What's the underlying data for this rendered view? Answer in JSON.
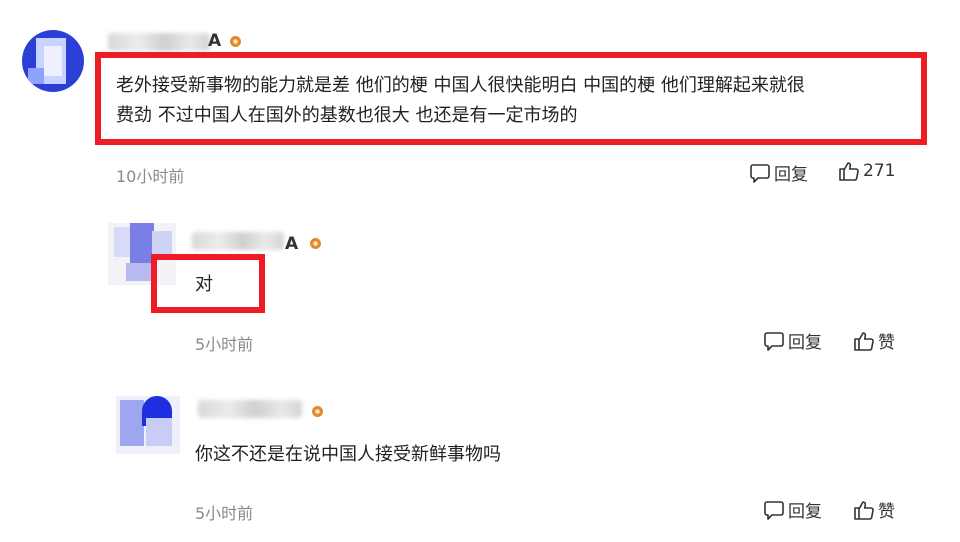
{
  "comments": [
    {
      "username_visible_tail": "A",
      "text": "老外接受新事物的能力就是差 他们的梗 中国人很快能明白 中国的梗 他们理解起来就很费劲 不过中国人在国外的基数也很大 也还是有一定市场的",
      "text_line1": "老外接受新事物的能力就是差 他们的梗 中国人很快能明白 中国的梗 他们理解起来就很",
      "text_line2": "费劲 不过中国人在国外的基数也很大 也还是有一定市场的",
      "time": "10小时前",
      "reply_label": "回复",
      "like_label": "271",
      "highlighted": true
    },
    {
      "username_visible_tail": "A",
      "text": "对",
      "time": "5小时前",
      "reply_label": "回复",
      "like_label": "赞",
      "highlighted": true
    },
    {
      "username_visible_tail": "",
      "text": "你这不还是在说中国人接受新鲜事物吗",
      "time": "5小时前",
      "reply_label": "回复",
      "like_label": "赞",
      "highlighted": false
    }
  ],
  "colors": {
    "highlight_border": "#ee1c24",
    "timestamp": "#8a8a8a",
    "badge": "#e58a2c",
    "avatar_blue": "#2b3fd6"
  },
  "icons": {
    "reply": "speech-bubble-icon",
    "like": "thumbs-up-icon",
    "badge": "level-badge-icon"
  }
}
